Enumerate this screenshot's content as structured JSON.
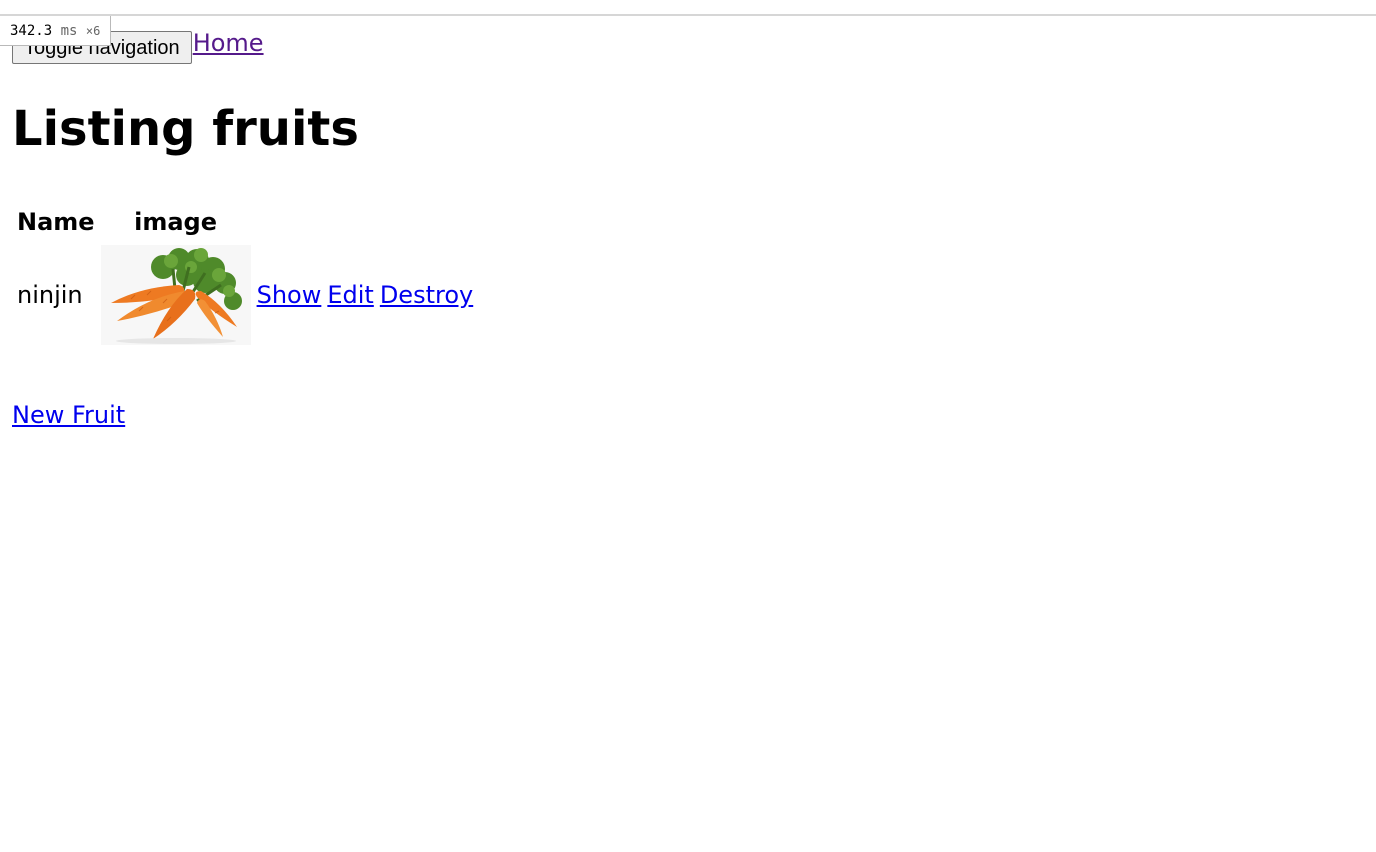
{
  "nav": {
    "toggle_label": "Toggle navigation",
    "home_label": "Home"
  },
  "profiler": {
    "time": "342.3",
    "unit": "ms",
    "count": "×6"
  },
  "page": {
    "title": "Listing fruits"
  },
  "table": {
    "headers": [
      "Name",
      "image"
    ],
    "rows": [
      {
        "name": "ninjin",
        "image_icon": "carrot-image",
        "actions": [
          "Show",
          "Edit",
          "Destroy"
        ]
      }
    ]
  },
  "footer": {
    "new_label": "New Fruit"
  },
  "colors": {
    "link": "#0000ee",
    "visited_link": "#551a8b"
  }
}
